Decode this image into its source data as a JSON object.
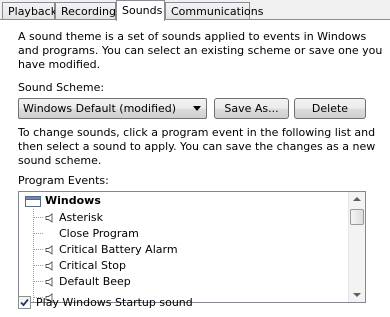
{
  "tabs": [
    {
      "label": "Playback"
    },
    {
      "label": "Recording"
    },
    {
      "label": "Sounds"
    },
    {
      "label": "Communications"
    }
  ],
  "intro": {
    "line1": "A sound theme is a set of sounds applied to events in Windows",
    "line2": "and programs.  You can select an existing scheme or save one you",
    "line3": "have modified."
  },
  "scheme": {
    "label": "Sound Scheme:",
    "selected": "Windows Default (modified)",
    "save_as": "Save As...",
    "delete": "Delete"
  },
  "instructions": {
    "line1": "To change sounds, click a program event in the following list and",
    "line2": "then select a sound to apply.  You can save the changes as a new",
    "line3": "sound scheme."
  },
  "events": {
    "label": "Program Events:",
    "items": [
      {
        "label": "Windows"
      },
      {
        "label": "Asterisk"
      },
      {
        "label": "Close Program"
      },
      {
        "label": "Critical Battery Alarm"
      },
      {
        "label": "Critical Stop"
      },
      {
        "label": "Default Beep"
      }
    ]
  },
  "startup": {
    "label": "Play Windows Startup sound",
    "checked": true
  }
}
